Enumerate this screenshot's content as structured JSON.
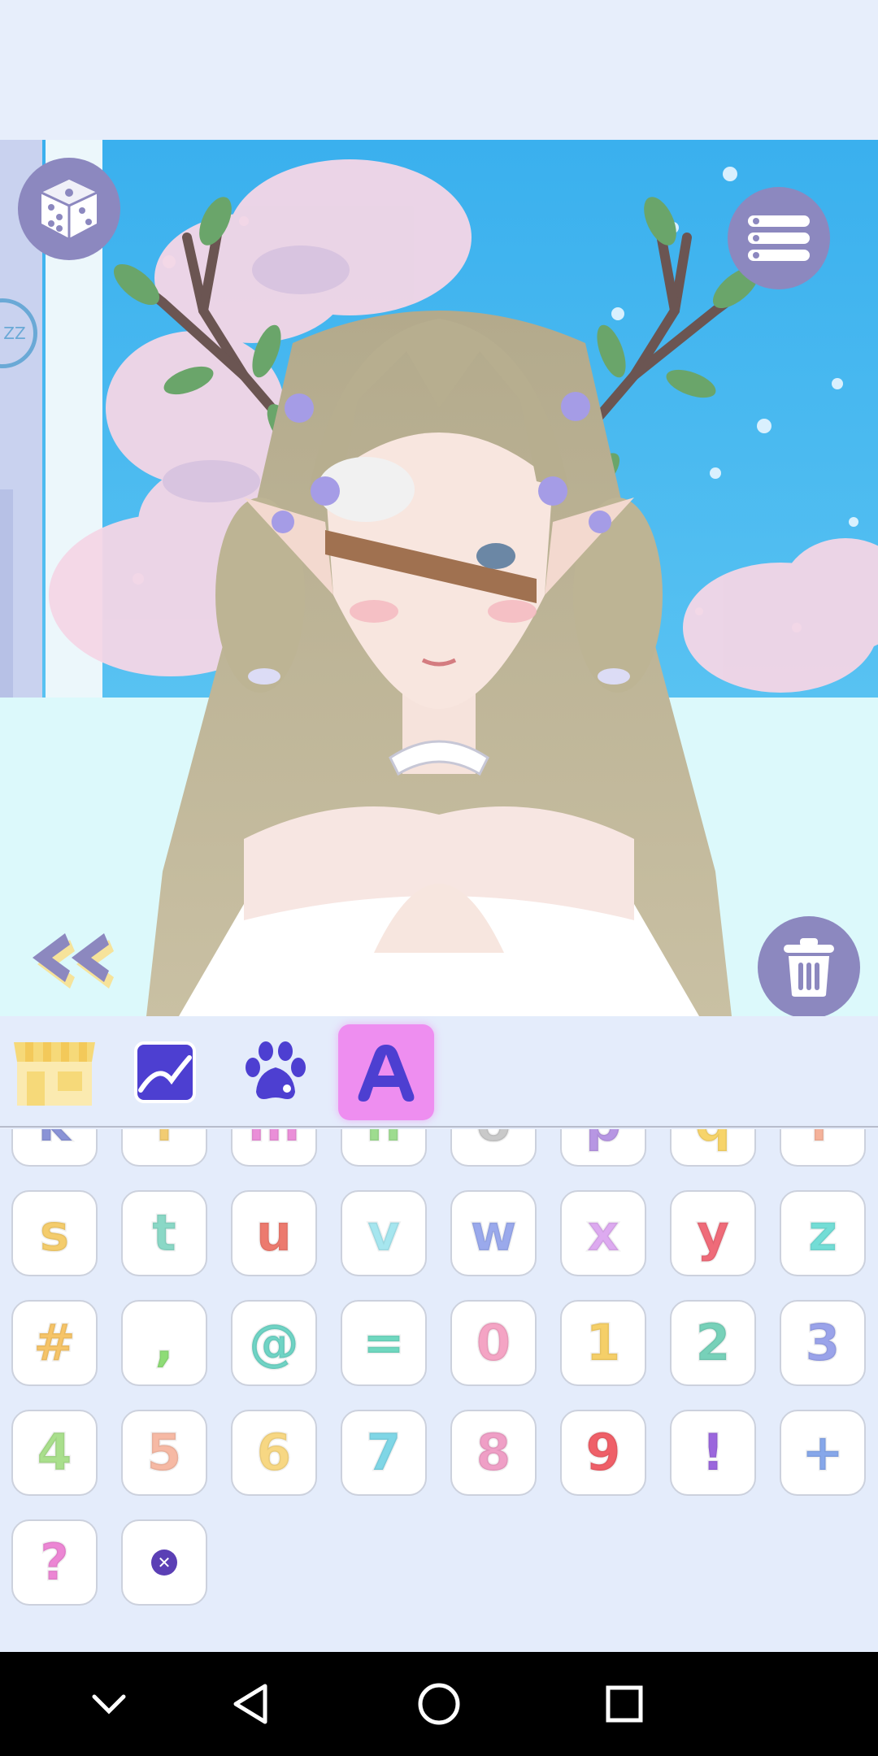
{
  "colors": {
    "accent_purple": "#8c88bf",
    "active_tab": "#ee8ef0",
    "panel_bg": "#e4ecfb",
    "sky": "#3fb2ee"
  },
  "toolbar": {
    "dice_icon": "dice-icon",
    "menu_icon": "list-menu-icon",
    "trash_icon": "trash-icon",
    "back_icon": "double-chevron-left-icon",
    "sleep_label": "ZZ"
  },
  "tabs": [
    {
      "name": "shop",
      "icon": "storefront-icon",
      "active": false
    },
    {
      "name": "background",
      "icon": "landscape-icon",
      "active": false
    },
    {
      "name": "pet",
      "icon": "paw-icon",
      "active": false
    },
    {
      "name": "text",
      "icon": "letter-a-icon",
      "active": true
    }
  ],
  "keys": [
    {
      "char": "k",
      "color": "#8a93d6"
    },
    {
      "char": "l",
      "color": "#f2cc72"
    },
    {
      "char": "m",
      "color": "#ea8ed8"
    },
    {
      "char": "n",
      "color": "#9edc8f"
    },
    {
      "char": "o",
      "color": "#c9c9c9"
    },
    {
      "char": "p",
      "color": "#b796e3"
    },
    {
      "char": "q",
      "color": "#f7d46a"
    },
    {
      "char": "r",
      "color": "#f5b29a"
    },
    {
      "char": "s",
      "color": "#f4cc6c"
    },
    {
      "char": "t",
      "color": "#8ad8c6"
    },
    {
      "char": "u",
      "color": "#ec7a6e"
    },
    {
      "char": "v",
      "color": "#a6e6ef"
    },
    {
      "char": "w",
      "color": "#9aa9ec"
    },
    {
      "char": "x",
      "color": "#ddaaf0"
    },
    {
      "char": "y",
      "color": "#ef6b79"
    },
    {
      "char": "z",
      "color": "#73ddd6"
    },
    {
      "char": "#",
      "color": "#f6c468"
    },
    {
      "char": ",",
      "color": "#8edc76"
    },
    {
      "char": "@",
      "color": "#6fd4c5"
    },
    {
      "char": "=",
      "color": "#6fd8c0"
    },
    {
      "char": "0",
      "color": "#f4a4c4"
    },
    {
      "char": "1",
      "color": "#f5cf68"
    },
    {
      "char": "2",
      "color": "#77d1b9"
    },
    {
      "char": "3",
      "color": "#9aa3ea"
    },
    {
      "char": "4",
      "color": "#a9df8c"
    },
    {
      "char": "5",
      "color": "#f6b9a4"
    },
    {
      "char": "6",
      "color": "#f7d783"
    },
    {
      "char": "7",
      "color": "#7fd6e6"
    },
    {
      "char": "8",
      "color": "#ef9fc6"
    },
    {
      "char": "9",
      "color": "#ef5f68"
    },
    {
      "char": "!",
      "color": "#9b66dd"
    },
    {
      "char": "+",
      "color": "#86a7ea"
    },
    {
      "char": "?",
      "color": "#ec86d4"
    },
    {
      "char": "clear",
      "color": "#5b3fb5"
    }
  ],
  "navbar": {
    "items": [
      "chevron-down-icon",
      "back-triangle-icon",
      "home-circle-icon",
      "recents-square-icon"
    ]
  }
}
